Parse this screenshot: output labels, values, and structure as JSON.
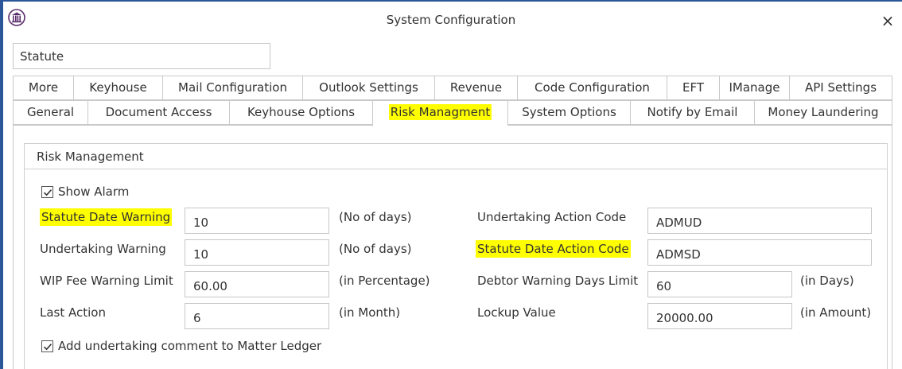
{
  "window": {
    "title": "System Configuration",
    "close_glyph": "×",
    "logo_icon": "courthouse-icon"
  },
  "search": {
    "value": "Statute"
  },
  "tabs_row1": [
    {
      "label": "More"
    },
    {
      "label": "Keyhouse"
    },
    {
      "label": "Mail Configuration"
    },
    {
      "label": "Outlook Settings"
    },
    {
      "label": "Revenue"
    },
    {
      "label": "Code Configuration"
    },
    {
      "label": "EFT"
    },
    {
      "label": "IManage"
    },
    {
      "label": "API Settings"
    }
  ],
  "tabs_row2": [
    {
      "label": "General"
    },
    {
      "label": "Document Access"
    },
    {
      "label": "Keyhouse Options"
    },
    {
      "label": "Risk Managment",
      "active": true,
      "highlighted": true
    },
    {
      "label": "System Options"
    },
    {
      "label": "Notify by Email"
    },
    {
      "label": "Money Laundering"
    }
  ],
  "risk_management": {
    "group_title": "Risk Management",
    "show_alarm": {
      "label": "Show Alarm",
      "checked": true
    },
    "left": [
      {
        "label": "Statute Date Warning",
        "value": "10",
        "unit": "(No of days)",
        "highlighted": true
      },
      {
        "label": "Undertaking Warning",
        "value": "10",
        "unit": "(No of days)"
      },
      {
        "label": "WIP Fee Warning Limit",
        "value": "60.00",
        "unit": "(in Percentage)"
      },
      {
        "label": "Last Action",
        "value": "6",
        "unit": "(in Month)"
      }
    ],
    "right": [
      {
        "label": "Undertaking Action Code",
        "value": "ADMUD",
        "unit": ""
      },
      {
        "label": "Statute Date Action Code",
        "value": "ADMSD",
        "unit": "",
        "highlighted": true
      },
      {
        "label": "Debtor Warning Days Limit",
        "value": "60",
        "unit": "(in Days)"
      },
      {
        "label": "Lockup Value",
        "value": "20000.00",
        "unit": "(in Amount)"
      }
    ],
    "undertaking_comment": {
      "label": "Add undertaking comment to Matter Ledger",
      "checked": true
    }
  },
  "colors": {
    "highlight": "#ffff00",
    "border_accent": "#2b579a",
    "control_border": "#c6c6c6"
  }
}
